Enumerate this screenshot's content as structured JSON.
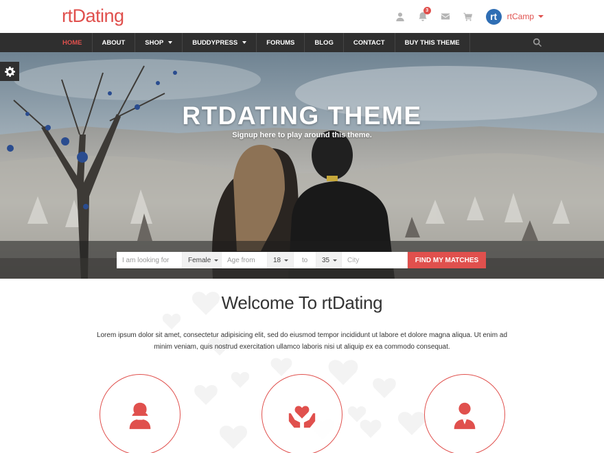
{
  "brand": {
    "name": "rtDating",
    "accent_color": "#e0504d"
  },
  "header": {
    "icons": [
      "user-icon",
      "bell-icon",
      "envelope-icon",
      "cart-icon"
    ],
    "notification_count": "3",
    "avatar_initials": "rt",
    "username": "rtCamp"
  },
  "nav": {
    "items": [
      {
        "label": "HOME",
        "active": true
      },
      {
        "label": "ABOUT"
      },
      {
        "label": "SHOP",
        "dropdown": true
      },
      {
        "label": "BUDDYPRESS",
        "dropdown": true
      },
      {
        "label": "FORUMS"
      },
      {
        "label": "BLOG"
      },
      {
        "label": "CONTACT"
      },
      {
        "label": "BUY THIS THEME"
      }
    ]
  },
  "hero": {
    "title": "RTDATING THEME",
    "subtitle": "Signup here to play around this theme."
  },
  "search": {
    "looking_for_label": "I am looking for",
    "gender_value": "Female",
    "age_from_label": "Age from",
    "age_min_value": "18",
    "to_label": "to",
    "age_max_value": "35",
    "city_placeholder": "City",
    "submit_label": "FIND MY MATCHES"
  },
  "welcome": {
    "title": "Welcome To rtDating",
    "text": "Lorem ipsum dolor sit amet, consectetur adipisicing elit, sed do eiusmod tempor incididunt ut labore et dolore magna aliqua. Ut enim ad minim veniam, quis nostrud exercitation ullamco laboris nisi ut aliquip ex ea commodo consequat."
  },
  "features": [
    "woman-icon",
    "heart-hands-icon",
    "man-icon"
  ]
}
